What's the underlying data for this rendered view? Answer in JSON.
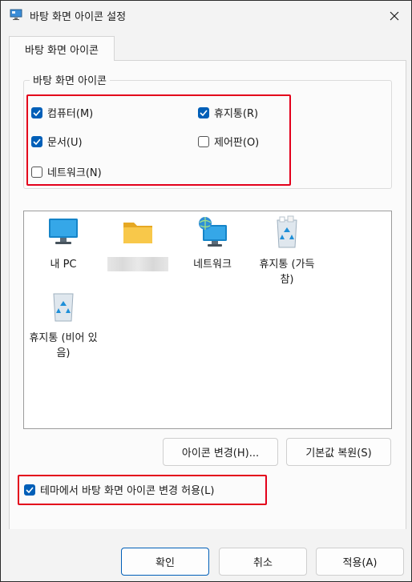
{
  "window": {
    "title": "바탕 화면 아이콘 설정"
  },
  "tab": {
    "label": "바탕 화면 아이콘"
  },
  "group": {
    "label": "바탕 화면 아이콘",
    "checkboxes": [
      {
        "label": "컴퓨터(M)",
        "checked": true
      },
      {
        "label": "휴지통(R)",
        "checked": true
      },
      {
        "label": "문서(U)",
        "checked": true
      },
      {
        "label": "제어판(O)",
        "checked": false
      },
      {
        "label": "네트워크(N)",
        "checked": false
      }
    ]
  },
  "icons": [
    {
      "name": "monitor-icon",
      "label": "내 PC"
    },
    {
      "name": "folder-icon",
      "label": ""
    },
    {
      "name": "network-icon",
      "label": "네트워크"
    },
    {
      "name": "recycle-bin-full-icon",
      "label": "휴지통 (가득 참)"
    },
    {
      "name": "recycle-bin-empty-icon",
      "label": "휴지통 (비어 있음)"
    }
  ],
  "buttons": {
    "change_icon": "아이콘 변경(H)...",
    "restore_default": "기본값 복원(S)",
    "ok": "확인",
    "cancel": "취소",
    "apply": "적용(A)"
  },
  "theme_checkbox": {
    "label": "테마에서 바탕 화면 아이콘 변경 허용(L)",
    "checked": true
  },
  "colors": {
    "accent": "#005fb8",
    "highlight": "#e3001b"
  }
}
